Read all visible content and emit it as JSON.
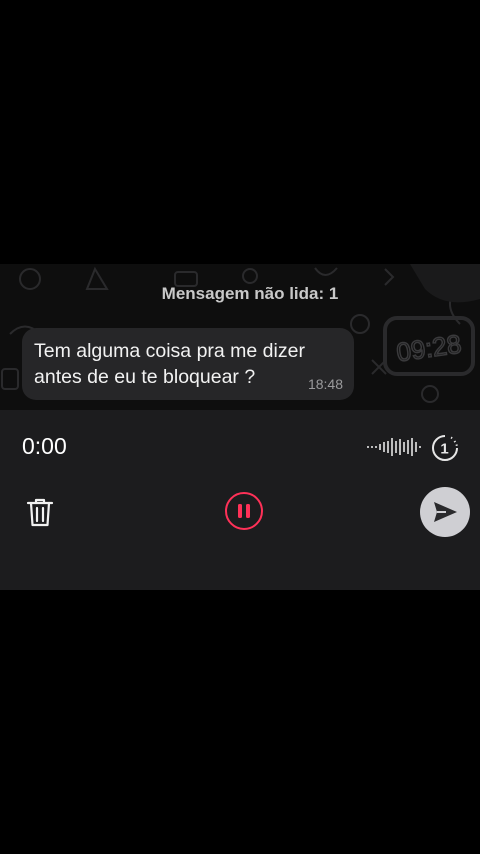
{
  "chat": {
    "unread_banner": "Mensagem não lida: 1",
    "message": {
      "text_line1": "Tem alguma coisa pra me dizer",
      "text_line2": "antes de eu te bloquear ?",
      "time": "18:48"
    },
    "wallpaper_clock_text": "09:28"
  },
  "recorder": {
    "elapsed": "0:00",
    "view_once_label": "1",
    "icons": [
      "waveform-icon",
      "view-once-icon",
      "trash-icon",
      "pause-icon",
      "send-icon"
    ],
    "accent_color": "#ff3158"
  }
}
